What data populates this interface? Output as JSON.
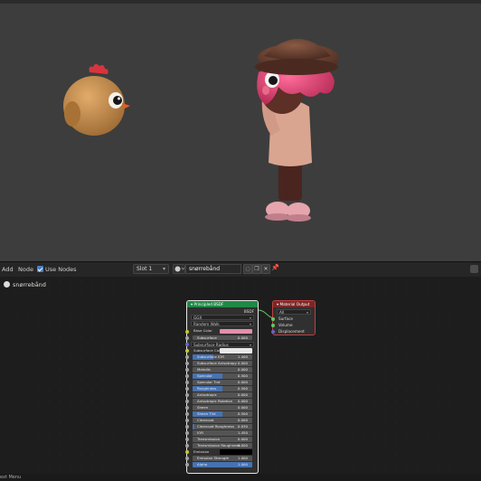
{
  "toolbar": {
    "add_label": "Add",
    "node_label": "Node",
    "use_nodes_label": "Use Nodes",
    "use_nodes_checked": true,
    "slot_value": "Slot 1",
    "material_name": "snørrebånd"
  },
  "breadcrumb": {
    "material_name": "snørrebånd"
  },
  "principled_node": {
    "title": "Principled BSDF",
    "output_label": "BSDF",
    "distribution": "GGX",
    "subsurface_method": "Random Walk",
    "rows": [
      {
        "type": "color",
        "label": "Base Color",
        "color": "#e68cac",
        "socket": "#c7c729"
      },
      {
        "type": "value",
        "label": "Subsurface",
        "value": "0.000",
        "fill": 0,
        "socket": "#a1a1a1"
      },
      {
        "type": "select",
        "label": "Subsurface Radius",
        "socket": "#6363c7"
      },
      {
        "type": "color",
        "label": "Subsurface Col",
        "color": "#e8e8e8",
        "socket": "#c7c729"
      },
      {
        "type": "value",
        "label": "Subsurface IOR",
        "value": "1.400",
        "fill": 0.35,
        "socket": "#a1a1a1"
      },
      {
        "type": "value",
        "label": "Subsurface Anisotropy",
        "value": "0.000",
        "fill": 0,
        "socket": "#a1a1a1"
      },
      {
        "type": "value",
        "label": "Metallic",
        "value": "0.000",
        "fill": 0,
        "socket": "#a1a1a1"
      },
      {
        "type": "value",
        "label": "Specular",
        "value": "0.500",
        "fill": 0.5,
        "socket": "#a1a1a1"
      },
      {
        "type": "value",
        "label": "Specular Tint",
        "value": "0.000",
        "fill": 0,
        "socket": "#a1a1a1"
      },
      {
        "type": "value",
        "label": "Roughness",
        "value": "0.500",
        "fill": 0.5,
        "socket": "#a1a1a1"
      },
      {
        "type": "value",
        "label": "Anisotropic",
        "value": "0.000",
        "fill": 0,
        "socket": "#a1a1a1"
      },
      {
        "type": "value",
        "label": "Anisotropic Rotation",
        "value": "0.000",
        "fill": 0,
        "socket": "#a1a1a1"
      },
      {
        "type": "value",
        "label": "Sheen",
        "value": "0.000",
        "fill": 0,
        "socket": "#a1a1a1"
      },
      {
        "type": "value",
        "label": "Sheen Tint",
        "value": "0.500",
        "fill": 0.5,
        "socket": "#a1a1a1"
      },
      {
        "type": "value",
        "label": "Clearcoat",
        "value": "0.000",
        "fill": 0,
        "socket": "#a1a1a1"
      },
      {
        "type": "value",
        "label": "Clearcoat Roughness",
        "value": "0.030",
        "fill": 0.03,
        "socket": "#a1a1a1"
      },
      {
        "type": "value",
        "label": "IOR",
        "value": "1.450",
        "fill": 0,
        "socket": "#a1a1a1"
      },
      {
        "type": "value",
        "label": "Transmission",
        "value": "0.000",
        "fill": 0,
        "socket": "#a1a1a1"
      },
      {
        "type": "value",
        "label": "Transmission Roughness",
        "value": "0.000",
        "fill": 0,
        "socket": "#a1a1a1"
      },
      {
        "type": "color",
        "label": "Emission",
        "color": "#000000",
        "socket": "#c7c729"
      },
      {
        "type": "value",
        "label": "Emission Strength",
        "value": "1.000",
        "fill": 0,
        "socket": "#a1a1a1"
      },
      {
        "type": "value",
        "label": "Alpha",
        "value": "1.000",
        "fill": 1,
        "socket": "#a1a1a1"
      }
    ]
  },
  "output_node": {
    "title": "Material Output",
    "target": "All",
    "inputs": [
      {
        "label": "Surface",
        "socket": "#63c763"
      },
      {
        "label": "Volume",
        "socket": "#63c763"
      },
      {
        "label": "Displacement",
        "socket": "#6363c7"
      }
    ]
  },
  "statusbar": {
    "text": "ext Menu"
  }
}
